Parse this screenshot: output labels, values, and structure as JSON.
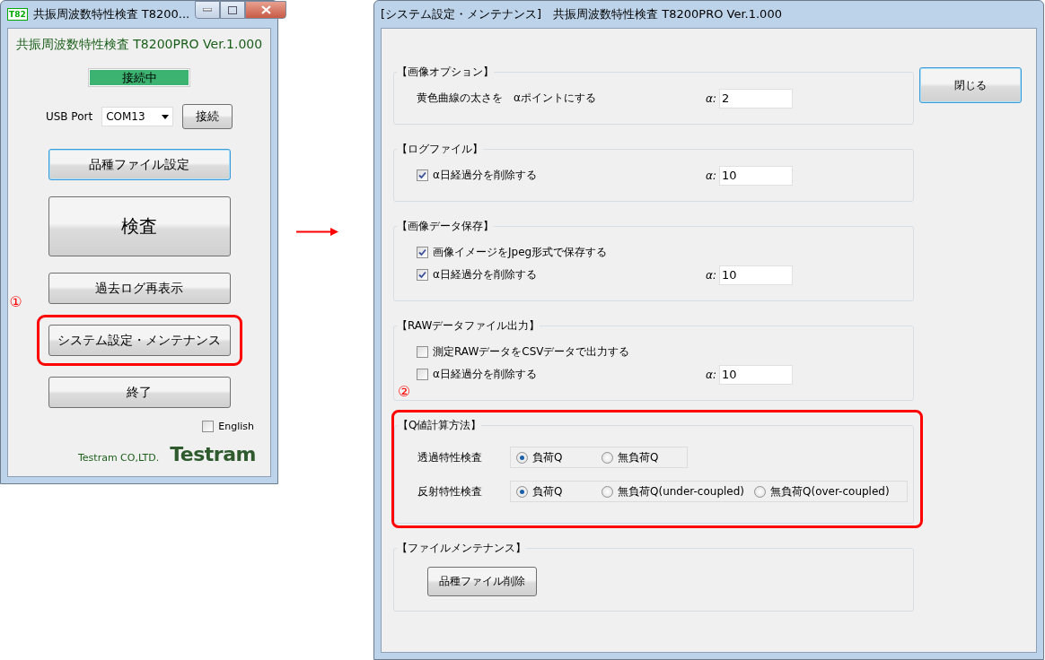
{
  "main_window": {
    "title": "共振周波数特性検査 T8200...",
    "app_icon": "T82",
    "heading": "共振周波数特性検査 T8200PRO Ver.1.000",
    "status": "接続中",
    "port_label": "USB Port",
    "port_value": "COM13",
    "connect_button": "接続",
    "buttons": [
      {
        "label": "品種ファイル設定",
        "kind": "normal",
        "focused": true,
        "highlighted": false
      },
      {
        "label": "検査",
        "kind": "large",
        "focused": false,
        "highlighted": false
      },
      {
        "label": "過去ログ再表示",
        "kind": "normal",
        "focused": false,
        "highlighted": false
      },
      {
        "label": "システム設定・メンテナンス",
        "kind": "normal",
        "focused": false,
        "highlighted": true,
        "callout": "①"
      },
      {
        "label": "終了",
        "kind": "normal",
        "focused": false,
        "highlighted": false
      }
    ],
    "english": {
      "label": "English",
      "checked": false
    },
    "company": "Testram CO,LTD.",
    "logo": "Testram"
  },
  "settings_window": {
    "title": "[システム設定・メンテナンス]　共振周波数特性検査 T8200PRO Ver.1.000",
    "close_button": "閉じる",
    "groups": [
      {
        "title": "【画像オプション】",
        "highlighted": false,
        "rows": [
          {
            "kind": "text",
            "label": "黄色曲線の太さを　αポイントにする",
            "alpha_label": "α:",
            "value": "2"
          }
        ]
      },
      {
        "title": "【ログファイル】",
        "highlighted": false,
        "rows": [
          {
            "kind": "check",
            "label": "α日経過分を削除する",
            "checked": true,
            "alpha_label": "α:",
            "value": "10"
          }
        ]
      },
      {
        "title": "【画像データ保存】",
        "highlighted": false,
        "rows": [
          {
            "kind": "check",
            "label": "画像イメージをJpeg形式で保存する",
            "checked": true
          },
          {
            "kind": "check",
            "label": "α日経過分を削除する",
            "checked": true,
            "alpha_label": "α:",
            "value": "10"
          }
        ]
      },
      {
        "title": "【RAWデータファイル出力】",
        "highlighted": false,
        "rows": [
          {
            "kind": "check",
            "label": "測定RAWデータをCSVデータで出力する",
            "checked": false
          },
          {
            "kind": "check",
            "label": "α日経過分を削除する",
            "checked": false,
            "alpha_label": "α:",
            "value": "10"
          }
        ]
      },
      {
        "title": "【Q値計算方法】",
        "highlighted": true,
        "callout": "②",
        "rows": [
          {
            "kind": "radio",
            "label": "透過特性検査",
            "options": [
              {
                "label": "負荷Q",
                "selected": true
              },
              {
                "label": "無負荷Q",
                "selected": false
              }
            ]
          },
          {
            "kind": "radio",
            "label": "反射特性検査",
            "options": [
              {
                "label": "負荷Q",
                "selected": true
              },
              {
                "label": "無負荷Q(under-coupled)",
                "selected": false
              },
              {
                "label": "無負荷Q(over-coupled)",
                "selected": false
              }
            ]
          }
        ]
      },
      {
        "title": "【ファイルメンテナンス】",
        "highlighted": false,
        "rows": [
          {
            "kind": "button",
            "label": "品種ファイル削除"
          }
        ]
      }
    ]
  }
}
